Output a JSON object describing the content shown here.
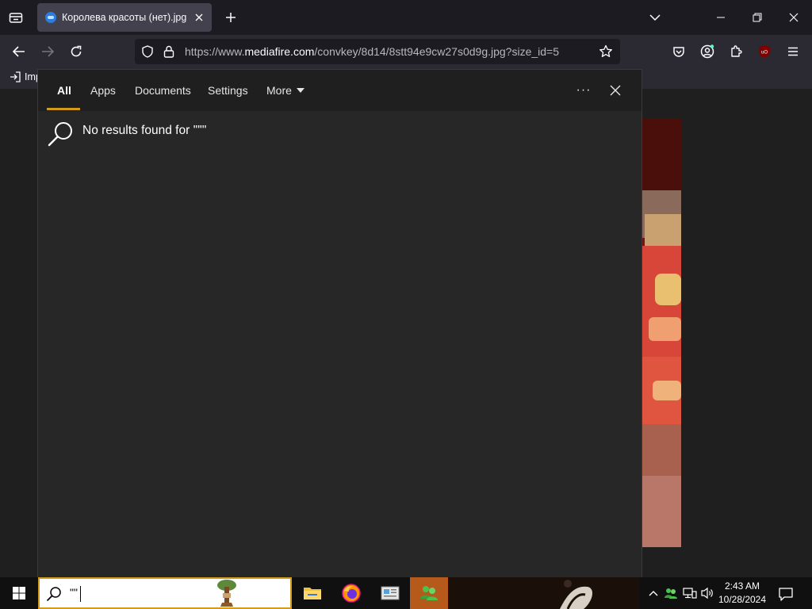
{
  "browser": {
    "tab": {
      "title": "Королева красоты (нет).jpg (JI"
    },
    "url": {
      "scheme": "https://www.",
      "host": "mediafire.com",
      "path": "/convkey/8d14/8stt94e9cw27s0d9g.jpg?size_id=5"
    },
    "bookmarks": {
      "import_label": "Imp"
    }
  },
  "search_panel": {
    "tabs": [
      {
        "label": "All"
      },
      {
        "label": "Apps"
      },
      {
        "label": "Documents"
      },
      {
        "label": "Settings"
      },
      {
        "label": "More"
      }
    ],
    "more_options": "···",
    "message": "No results found for '\"\"'"
  },
  "taskbar": {
    "search_query": "\"\"",
    "clock": {
      "time": "2:43 AM",
      "date": "10/28/2024"
    }
  },
  "colors": {
    "accent": "#d29b1a",
    "panel_bg": "#272727",
    "header_bg": "#1f1f1f",
    "taskbar_bg": "#101010",
    "active_app": "#b55a1a"
  },
  "icons": [
    "tab-list-icon",
    "close-icon",
    "plus-icon",
    "chevron-down-icon",
    "minimize-icon",
    "restore-icon",
    "back-icon",
    "forward-icon",
    "reload-icon",
    "shield-icon",
    "lock-icon",
    "star-icon",
    "pocket-icon",
    "account-icon",
    "extensions-icon",
    "ublock-icon",
    "menu-icon",
    "search-icon",
    "windows-logo-icon",
    "file-explorer-icon",
    "firefox-icon",
    "news-icon",
    "people-icon",
    "chevron-up-icon",
    "network-icon",
    "volume-icon",
    "notification-icon"
  ]
}
